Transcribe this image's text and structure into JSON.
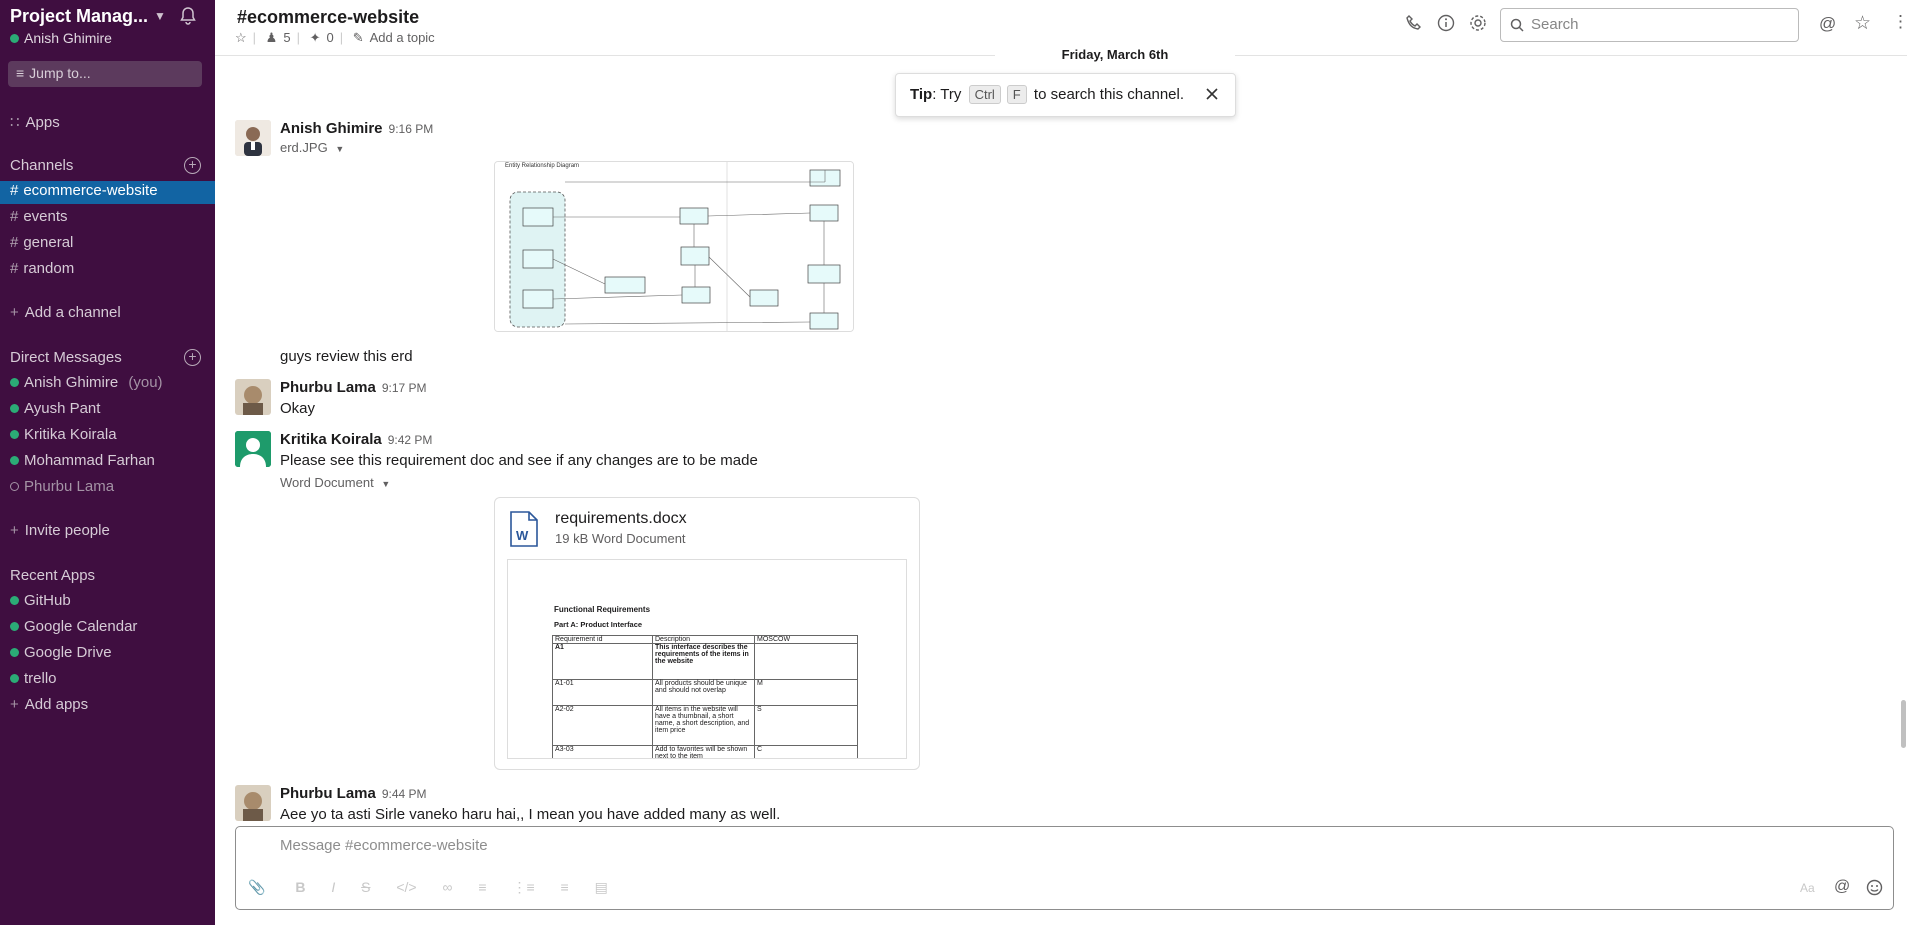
{
  "workspace": {
    "name": "Project Manag...",
    "user": "Anish Ghimire",
    "jump_label": "Jump to..."
  },
  "sidebar": {
    "apps_label": "Apps",
    "channels_heading": "Channels",
    "channels": [
      {
        "label": "ecommerce-website",
        "active": true
      },
      {
        "label": "events"
      },
      {
        "label": "general"
      },
      {
        "label": "random"
      }
    ],
    "add_channel": "Add a channel",
    "dm_heading": "Direct Messages",
    "dms": [
      {
        "label": "Anish Ghimire",
        "suffix": "(you)",
        "status": "online"
      },
      {
        "label": "Ayush Pant",
        "status": "online"
      },
      {
        "label": "Kritika Koirala",
        "status": "online"
      },
      {
        "label": "Mohammad Farhan",
        "status": "online"
      },
      {
        "label": "Phurbu Lama",
        "status": "away"
      }
    ],
    "invite": "Invite people",
    "recent_apps_heading": "Recent Apps",
    "apps": [
      "GitHub",
      "Google Calendar",
      "Google Drive",
      "trello"
    ],
    "add_apps": "Add apps"
  },
  "header": {
    "channel": "#ecommerce-website",
    "members": "5",
    "pins": "0",
    "add_topic": "Add a topic",
    "search_placeholder": "Search"
  },
  "date_divider": "Friday, March 6th",
  "tip": {
    "prefix": "Tip",
    "try": ": Try",
    "key1": "Ctrl",
    "key2": "F",
    "suffix": "to search this channel."
  },
  "messages": [
    {
      "author": "Anish Ghimire",
      "time": "9:16 PM",
      "file_name": "erd.JPG",
      "text": "guys review this erd",
      "erd_title": "Entity Relationship Diagram"
    },
    {
      "author": "Phurbu Lama",
      "time": "9:17 PM",
      "text": "Okay"
    },
    {
      "author": "Kritika Koirala",
      "time": "9:42 PM",
      "text": "Please see this requirement doc and see if any changes are to be made",
      "file_caption": "Word Document",
      "doc": {
        "name": "requirements.docx",
        "size": "19 kB Word Document",
        "preview_title": "Functional Requirements",
        "preview_subtitle": "Part A: Product Interface",
        "preview_headers": [
          "Requirement id",
          "Description",
          "MOSCOW"
        ],
        "preview_rows": [
          [
            "A1",
            "This interface describes the requirements of the items in the website",
            ""
          ],
          [
            "A1-01",
            "All products should be unique and should not overlap",
            "M"
          ],
          [
            "A2-02",
            "All items in the website will have a thumbnail, a short name, a short description, and item price",
            "S"
          ],
          [
            "A3-03",
            "Add to favorites will be shown next to the item",
            "C"
          ]
        ]
      }
    },
    {
      "author": "Phurbu Lama",
      "time": "9:44 PM",
      "text": "Aee yo ta asti Sirle vaneko haru hai,, I mean you have added many as well."
    }
  ],
  "composer": {
    "placeholder": "Message #ecommerce-website",
    "format_hint": "Aa"
  },
  "colors": {
    "sidebar": "#3f0e40",
    "active": "#1264a3",
    "online": "#2bac76"
  }
}
